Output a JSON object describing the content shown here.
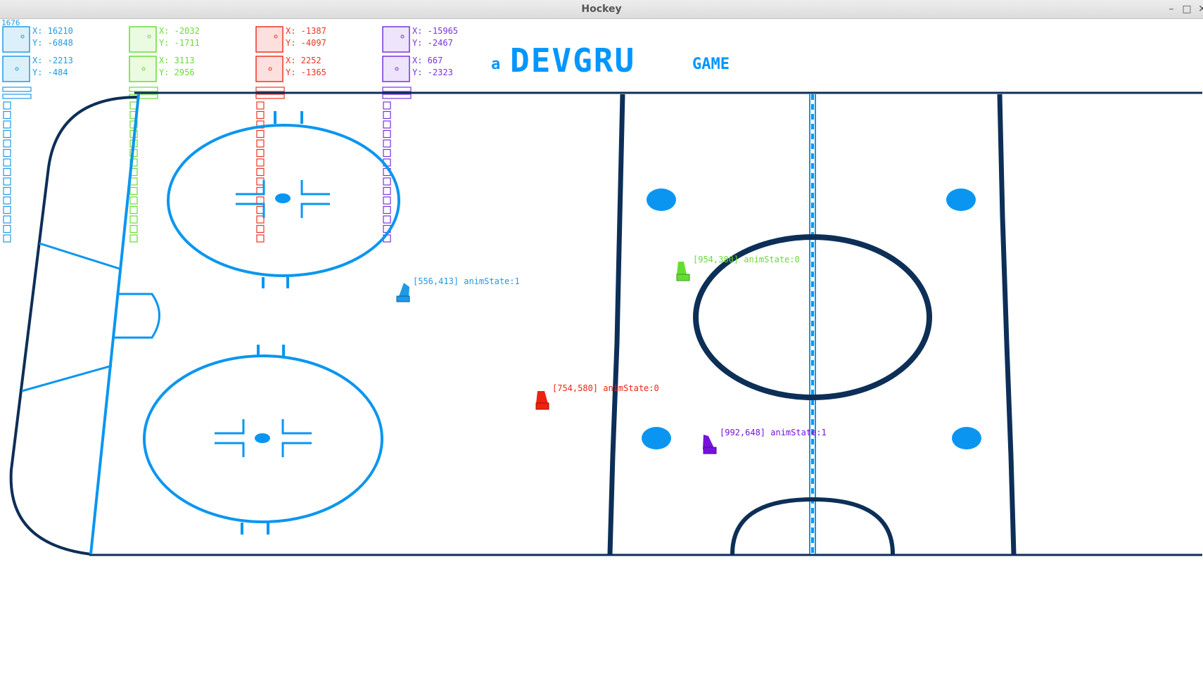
{
  "window": {
    "title": "Hockey",
    "min_glyph": "–",
    "max_glyph": "□",
    "close_glyph": "✕"
  },
  "frame_counter": "1676",
  "logo": {
    "prefix": "a",
    "main": "DEVGRU",
    "suffix": "GAME",
    "color": "#0096ff"
  },
  "rink_colors": {
    "navy": "#0d2f57",
    "blue": "#0a96f0"
  },
  "hud": [
    {
      "color": "#1e9ae6",
      "fill": "#dcf0fb",
      "rows": [
        {
          "x": "X: 16210",
          "y": "Y: -6848"
        },
        {
          "x": "X: -2213",
          "y": "Y: -484"
        }
      ]
    },
    {
      "color": "#66dd33",
      "fill": "#eafbe2",
      "rows": [
        {
          "x": "X: -2032",
          "y": "Y: -1711"
        },
        {
          "x": "X: 3113",
          "y": "Y: 2956"
        }
      ]
    },
    {
      "color": "#ee3322",
      "fill": "#fbe0de",
      "rows": [
        {
          "x": "X: -1387",
          "y": "Y: -4097"
        },
        {
          "x": "X: 2252",
          "y": "Y: -1365"
        }
      ]
    },
    {
      "color": "#7733dd",
      "fill": "#eee4fb",
      "rows": [
        {
          "x": "X: -15965",
          "y": "Y: -2467"
        },
        {
          "x": "X: 667",
          "y": "Y: -2323"
        }
      ]
    }
  ],
  "players": [
    {
      "label": "[556,413] animState:1",
      "color": "#1e9ae6"
    },
    {
      "label": "[954,380] animState:0",
      "color": "#66dd33"
    },
    {
      "label": "[754,580] animState:0",
      "color": "#ee2211"
    },
    {
      "label": "[992,648] animState:1",
      "color": "#7711dd"
    }
  ]
}
